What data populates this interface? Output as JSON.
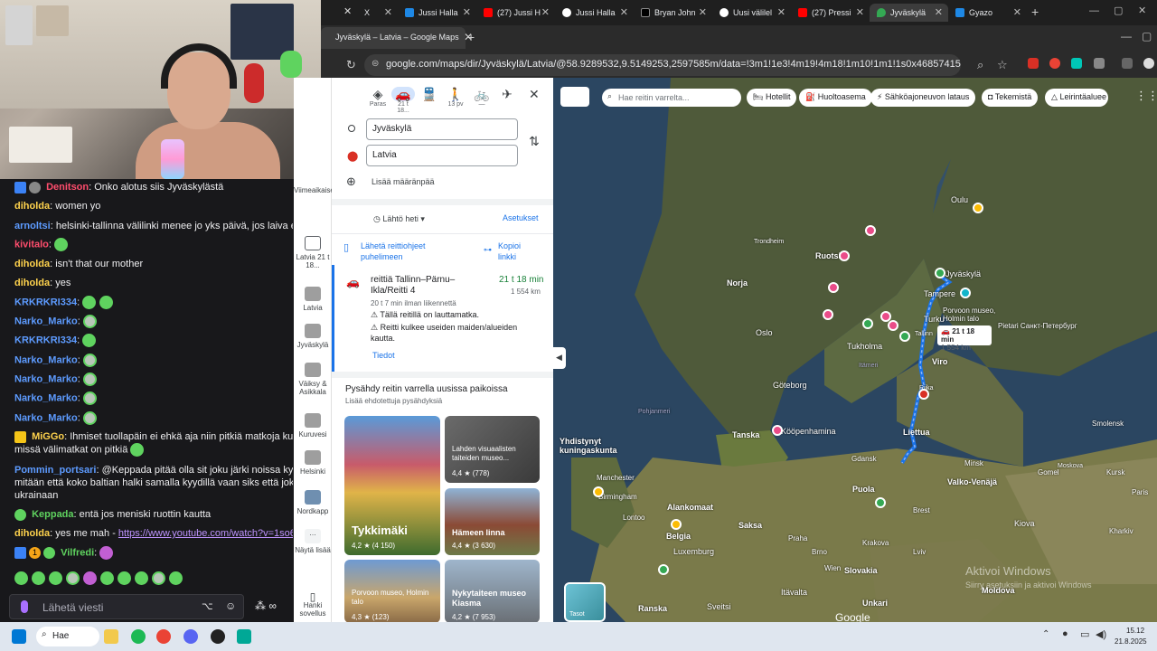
{
  "chat": {
    "messages": [
      {
        "user": "Denitson",
        "user_color": "#ff4d6d",
        "sep": ": ",
        "text": "Onko alotus siis Jyväskylästä"
      },
      {
        "user": "diholda",
        "user_color": "#ffd34d",
        "sep": ": ",
        "text": "women yo"
      },
      {
        "user": "arnoltsi",
        "user_color": "#5d9bff",
        "sep": ": ",
        "text": "helsinki-tallinna välilinki menee jo yks päivä, jos laiva ei lähd"
      },
      {
        "user": "kivitalo",
        "user_color": "#ff4d6d",
        "sep": ": ",
        "text": ""
      },
      {
        "user": "diholda",
        "user_color": "#ffd34d",
        "sep": ": ",
        "text": "isn't that our mother"
      },
      {
        "user": "diholda",
        "user_color": "#ffd34d",
        "sep": ": ",
        "text": "yes"
      },
      {
        "user": "KRKRKRI334",
        "user_color": "#5d9bff",
        "sep": ": ",
        "text": ""
      },
      {
        "user": "Narko_Marko",
        "user_color": "#5d9bff",
        "sep": ": ",
        "text": ""
      },
      {
        "user": "KRKRKRI334",
        "user_color": "#5d9bff",
        "sep": ": ",
        "text": ""
      },
      {
        "user": "Narko_Marko",
        "user_color": "#5d9bff",
        "sep": ": ",
        "text": ""
      },
      {
        "user": "Narko_Marko",
        "user_color": "#5d9bff",
        "sep": ": ",
        "text": ""
      },
      {
        "user": "Narko_Marko",
        "user_color": "#5d9bff",
        "sep": ": ",
        "text": ""
      },
      {
        "user": "Narko_Marko",
        "user_color": "#5d9bff",
        "sep": ": ",
        "text": ""
      }
    ],
    "miggo": {
      "user": "MiGGo",
      "text": "Ihmiset tuollapäin ei ehkä aja niin pitkiä matkoja kuin tuol",
      "text2": "missä välimatkat on pitkiä"
    },
    "pommin": {
      "user": "Pommin_portsari",
      "text": "@Keppada pitää olla sit joku järki noissa kyytien n",
      "text2": "mitään että koko baltian halki samalla kyydillä vaan siks että joku on n",
      "text3": "ukrainaan"
    },
    "keppada": {
      "user": "Keppada",
      "text": "entä jos meniski ruottin kautta"
    },
    "diholda_link": {
      "user": "diholda",
      "text": "yes me mah - ",
      "link": "https://www.youtube.com/watch?v=1so6Mvm"
    },
    "vilfredi": {
      "user": "Vilfredi",
      "badge_count": "1"
    },
    "input_placeholder": "Lähetä viesti"
  },
  "browser": {
    "tabs": [
      {
        "label": "X",
        "color": "#000000"
      },
      {
        "label": "Jussi Halla",
        "color": "#1e88e5"
      },
      {
        "label": "(27) Jussi H",
        "color": "#ff0000"
      },
      {
        "label": "Jussi Halla",
        "color": "#ffffff"
      },
      {
        "label": "Bryan John",
        "color": "#000000"
      },
      {
        "label": "Uusi välilel",
        "color": "#ffffff"
      },
      {
        "label": "(27) Pressi",
        "color": "#ff0000"
      },
      {
        "label": "Jyväskylä",
        "color": "#34a853"
      },
      {
        "label": "Gyazo",
        "color": "#1e88e5"
      }
    ],
    "bookmark_title": "Jyväskylä – Latvia – Google Maps",
    "url": "google.com/maps/dir/Jyväskylä/Latvia/@58.9289532,9.5149253,2597585m/data=!3m1!1e3!4m19!4m18!1m10!1m1!1s0x46857415d4a93119:0xba5769..."
  },
  "rail": {
    "recent": "Viimeaikaiset",
    "items": [
      {
        "label": "Latvia 21 t 18...",
        "color": "#5f6368"
      },
      {
        "label": "Latvia",
        "color": "#8a8a8a"
      },
      {
        "label": "Jyväskylä",
        "color": "#7a7a7a"
      },
      {
        "label": "Väiksy & Asikkala",
        "color": "#9a9a9a"
      },
      {
        "label": "Kuruvesi",
        "color": "#a5a5a5"
      },
      {
        "label": "Helsinki",
        "color": "#8a8a8a"
      },
      {
        "label": "Nordkapp",
        "color": "#6f8fb0"
      }
    ],
    "more": "Näytä lisää",
    "get_app": "Hanki sovellus"
  },
  "directions": {
    "modes": [
      {
        "icon": "◈",
        "label": "Paras"
      },
      {
        "icon": "🚗",
        "label": "21 t 18..."
      },
      {
        "icon": "🚆",
        "label": ""
      },
      {
        "icon": "🚶",
        "label": "13 pv"
      },
      {
        "icon": "🚲",
        "label": "—"
      },
      {
        "icon": "✈",
        "label": ""
      }
    ],
    "origin": "Jyväskylä",
    "destination": "Latvia",
    "add_destination": "Lisää määränpää",
    "depart": "Lähtö heti",
    "settings": "Asetukset",
    "send_to_phone": "Lähetä reittiohjeet puhelimeen",
    "copy_link": "Kopioi linkki",
    "route": {
      "name": "reittiä Tallinn–Pärnu–Ikla/Reitti 4",
      "duration": "21 t 18 min",
      "distance": "1 554 km",
      "no_traffic": "20 t 7 min ilman liikennettä",
      "warning1": "Tällä reitillä on lauttamatka.",
      "warning2": "Reitti kulkee useiden maiden/alueiden kautta.",
      "details": "Tiedot"
    },
    "stops_title": "Pysähdy reitin varrella uusissa paikoissa",
    "stops_subtitle": "Lisää ehdotettuja pysähdyksiä",
    "places": [
      {
        "name": "Tykkimäki",
        "rating": "4,2",
        "count": "(4 150)"
      },
      {
        "name": "Lahden visuaalisten taiteiden museo...",
        "rating": "4,4",
        "count": "(778)"
      },
      {
        "name": "Hämeen linna",
        "rating": "4,4",
        "count": "(3 630)"
      },
      {
        "name": "Porvoon museo, Holmin talo",
        "rating": "4,3",
        "count": "(123)"
      },
      {
        "name": "Nykytaiteen museo Kiasma",
        "rating": "4,2",
        "count": "(7 953)"
      }
    ]
  },
  "map": {
    "search_placeholder": "Hae reitin varrelta...",
    "chips": [
      "Hotellit",
      "Huoltoasema",
      "Sähköajoneuvon lataus",
      "Tekemistä",
      "Leirintäaluee"
    ],
    "route_label_time": "21 t 18 min",
    "route_label_km": "1 554 km",
    "labels": {
      "oulu": "Oulu",
      "trondheim": "Trondheim",
      "ruotsi": "Ruotsi",
      "norja": "Norja",
      "oslo": "Oslo",
      "goteborg": "Göteborg",
      "tanska": "Tanska",
      "kopenhamina": "Kööpenhamina",
      "jyvaskyla": "Jyväskylä",
      "tampere": "Tampere",
      "turku": "Turku",
      "tukholma": "Tukholma",
      "tallinn": "Tallinn",
      "viro": "Viro",
      "pietari": "Pietari Санкт-Петербург",
      "liettua": "Liettua",
      "riika": "Riika",
      "gdansk": "Gdansk",
      "minsk": "Minsk",
      "valkovenaja": "Valko-Venäjä",
      "puola": "Puola",
      "yhdistynyt": "Yhdistynyt kuningaskunta",
      "manchester": "Manchester",
      "birmingham": "Birmingham",
      "lontoo": "Lontoo",
      "alankomaat": "Alankomaat",
      "belgia": "Belgia",
      "luxemburg": "Luxemburg",
      "saksa": "Saksa",
      "praha": "Praha",
      "wien": "Wien",
      "slovakia": "Slovakia",
      "unkari": "Unkari",
      "itavalta": "Itävalta",
      "sveitsi": "Sveitsi",
      "ranska": "Ranska",
      "kiova": "Kiova",
      "moldova": "Moldova",
      "pohjanmeri": "Pohjanmeri",
      "itameri": "Itämeri",
      "porvoo": "Porvoon museo, Holmin talo",
      "moskova": "Moskova",
      "smolensk": "Smolensk",
      "paris": "Paris",
      "brno": "Brno",
      "krakova": "Krakova",
      "lviv": "Lviv",
      "brest": "Brest",
      "gomel": "Gomel",
      "kharkiv": "Kharkiv",
      "kursk": "Kursk"
    },
    "layers": "Tasot",
    "watermark1": "Aktivoi Windows",
    "watermark2": "Siirry asetuksiin ja aktivoi Windows",
    "google": "Google"
  },
  "taskbar": {
    "search": "Hae",
    "time": "15.12",
    "date": "21.8.2025"
  }
}
